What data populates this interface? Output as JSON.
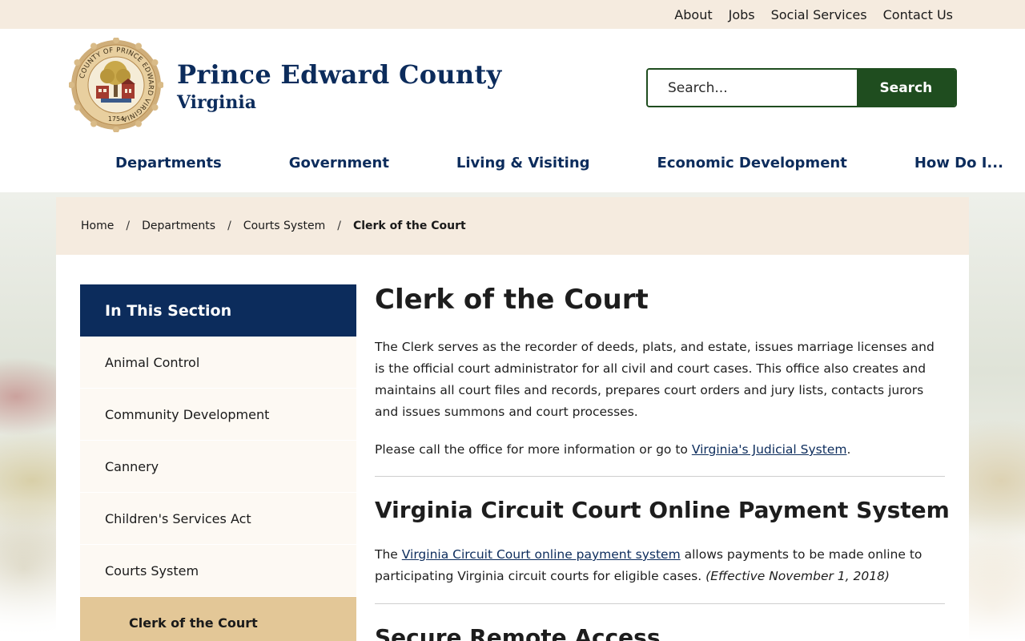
{
  "utility_nav": [
    "About",
    "Jobs",
    "Social Services",
    "Contact Us"
  ],
  "brand": {
    "title": "Prince Edward County",
    "subtitle": "Virginia",
    "seal_text": "COUNTY OF PRINCE EDWARD VIRGINIA",
    "seal_year": "1754"
  },
  "search": {
    "placeholder": "Search...",
    "button_label": "Search"
  },
  "main_nav": [
    "Departments",
    "Government",
    "Living & Visiting",
    "Economic Development",
    "How Do I..."
  ],
  "breadcrumb": {
    "items": [
      "Home",
      "Departments",
      "Courts System"
    ],
    "separator": "/",
    "current": "Clerk of the Court"
  },
  "sidebar": {
    "heading": "In This Section",
    "items": [
      "Animal Control",
      "Community Development",
      "Cannery",
      "Children's Services Act",
      "Courts System"
    ],
    "active_item": "Clerk of the Court"
  },
  "article": {
    "title": "Clerk of the Court",
    "intro": "The Clerk serves as the recorder of deeds, plats, and estate, issues marriage licenses and is the official court administrator for all civil and court cases. This office also creates and maintains all court files and records, prepares court orders and jury lists, contacts jurors and issues summons and court processes.",
    "call_prefix": "Please call the office for more information or go to ",
    "call_link": "Virginia's Judicial System",
    "call_suffix": ".",
    "section1_title": "Virginia Circuit Court Online Payment System",
    "payment_prefix": "The ",
    "payment_link": "Virginia Circuit Court online payment system",
    "payment_suffix": " allows payments to be made online to participating Virginia circuit courts for eligible cases. ",
    "payment_note": "(Effective November 1, 2018)",
    "section2_title": "Secure Remote Access"
  },
  "colors": {
    "navy": "#0c2c5c",
    "green": "#1f4d1f",
    "cream": "#f5ebdf",
    "active_tan": "#e3c797"
  }
}
